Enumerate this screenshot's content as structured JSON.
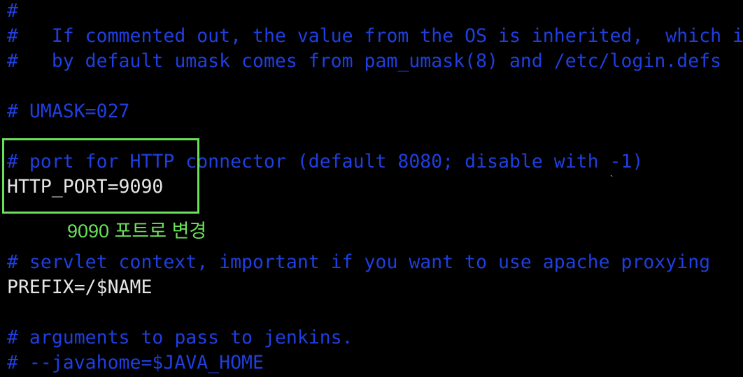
{
  "terminal": {
    "lines": [
      {
        "text": "#",
        "kind": "comment"
      },
      {
        "text": "#   If commented out, the value from the OS is inherited,  which i",
        "kind": "comment"
      },
      {
        "text": "#   by default umask comes from pam_umask(8) and /etc/login.defs",
        "kind": "comment"
      },
      {
        "text": "",
        "kind": "blank"
      },
      {
        "text": "# UMASK=027",
        "kind": "comment"
      },
      {
        "text": "",
        "kind": "blank"
      },
      {
        "text": "# port for HTTP connector (default 8080; disable with -1)",
        "kind": "comment"
      },
      {
        "text": "HTTP_PORT=9090",
        "kind": "text"
      },
      {
        "text": "",
        "kind": "blank"
      },
      {
        "text": "# servlet context, important if you want to use apache proxying",
        "kind": "comment"
      },
      {
        "text": "PREFIX=/$NAME",
        "kind": "text"
      },
      {
        "text": "",
        "kind": "blank"
      },
      {
        "text": "# arguments to pass to jenkins.",
        "kind": "comment"
      },
      {
        "text": "# --javahome=$JAVA_HOME",
        "kind": "comment"
      }
    ]
  },
  "annotation": {
    "label": "9090 포트로 변경"
  },
  "colors": {
    "comment": "#1f3fe0",
    "text": "#e6e6e6",
    "highlight": "#6be05a",
    "background": "#000000"
  }
}
